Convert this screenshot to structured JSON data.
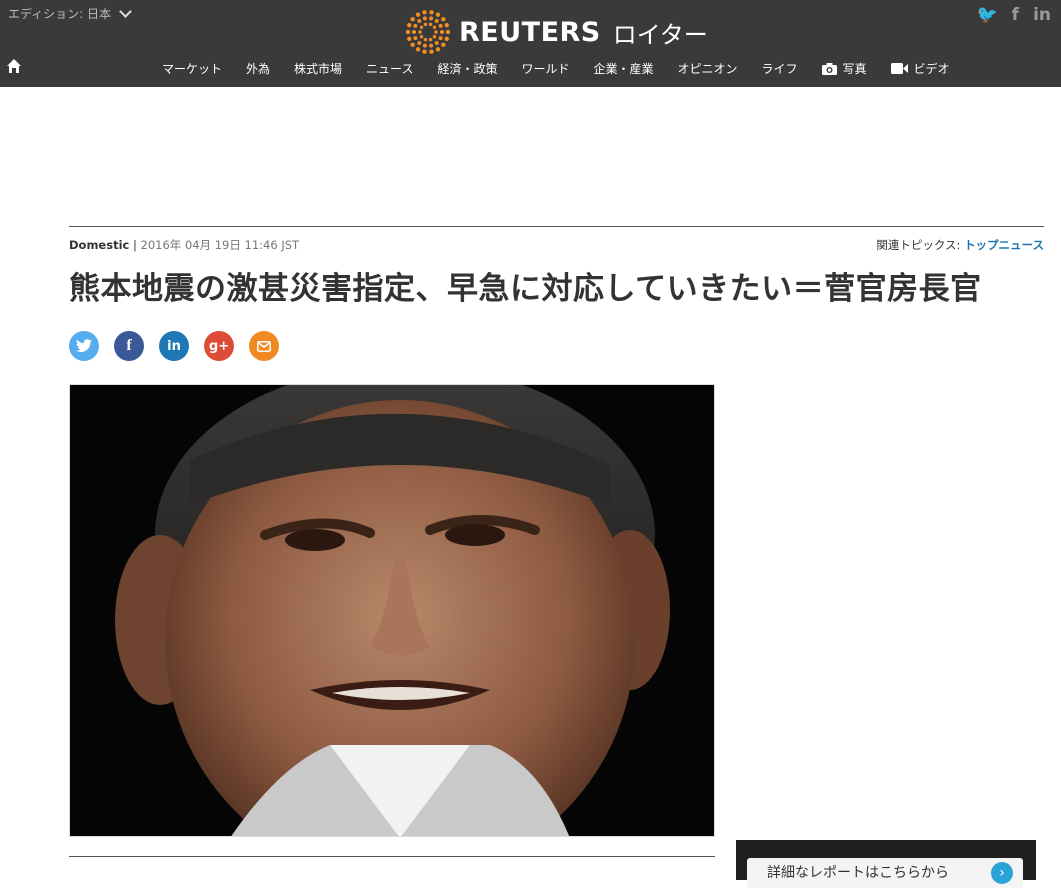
{
  "header": {
    "edition_label": "エディション: 日本",
    "brand": "REUTERS",
    "brand_jp": "ロイター",
    "social": [
      "twitter-icon",
      "facebook-icon",
      "linkedin-icon"
    ],
    "social_glyphs": {
      "twitter": "🐦",
      "facebook": "f",
      "linkedin": "in"
    }
  },
  "nav": {
    "items": [
      {
        "label": "マーケット"
      },
      {
        "label": "外為"
      },
      {
        "label": "株式市場"
      },
      {
        "label": "ニュース"
      },
      {
        "label": "経済・政策"
      },
      {
        "label": "ワールド"
      },
      {
        "label": "企業・産業"
      },
      {
        "label": "オピニオン"
      },
      {
        "label": "ライフ"
      },
      {
        "label": "写真",
        "icon": "camera-icon"
      },
      {
        "label": "ビデオ",
        "icon": "video-icon"
      }
    ]
  },
  "article": {
    "category": "Domestic",
    "separator": "|",
    "date": "2016年 04月 19日 11:46 JST",
    "topics_label": "関連トピックス:",
    "topics_link": "トップニュース",
    "headline": "熊本地震の激甚災害指定、早急に対応していきたい＝菅官房長官"
  },
  "share": [
    {
      "name": "twitter",
      "glyph": "t",
      "color": "#55acee"
    },
    {
      "name": "facebook",
      "glyph": "f",
      "color": "#3b5998"
    },
    {
      "name": "linkedin",
      "glyph": "in",
      "color": "#1e78b4"
    },
    {
      "name": "googleplus",
      "glyph": "g+",
      "color": "#dd4b39"
    },
    {
      "name": "email",
      "glyph": "✉",
      "color": "#f08a24"
    }
  ],
  "ad": {
    "cta_text": "詳細なレポートはこちらから",
    "arrow": "›"
  },
  "colors": {
    "header_bg": "#3a3a3a",
    "brand_orange": "#f28b22",
    "link_blue": "#1a73b5"
  }
}
